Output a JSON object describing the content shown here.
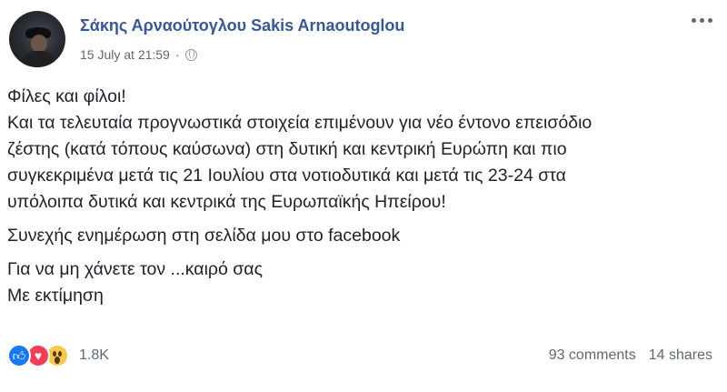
{
  "post": {
    "author": "Σάκης Αρναούτογλου Sakis Arnaoutoglou",
    "timestamp": "15 July at 21:59",
    "separator": "·",
    "privacy_icon": "globe-icon",
    "lines": [
      "Φίλες και φίλοι!",
      "Και τα τελευταία προγνωστικά στοιχεία επιμένουν για νέο έντονο επεισόδιο",
      "ζέστης (κατά τόπους καύσωνα) στη δυτική και κεντρική Ευρώπη και πιο",
      "συγκεκριμένα μετά τις 21 Ιουλίου στα νοτιοδυτικά και μετά τις 23-24 στα",
      "υπόλοιπα δυτικά και κεντρικά της Ευρωπαϊκής Ηπείρου!"
    ],
    "update_line": "Συνεχής ενημέρωση στη σελίδα μου στο facebook",
    "closing_lines": [
      "Για να μη χάνετε τον ...καιρό σας",
      "Με εκτίμηση"
    ]
  },
  "footer": {
    "reactions": [
      "like-icon",
      "love-icon",
      "wow-icon"
    ],
    "reaction_count": "1.8K",
    "comments": "93 comments",
    "shares": "14 shares"
  },
  "colors": {
    "author": "#365899",
    "like": "#1877f2",
    "love": "#f33e58",
    "wow": "#f7c84a"
  }
}
